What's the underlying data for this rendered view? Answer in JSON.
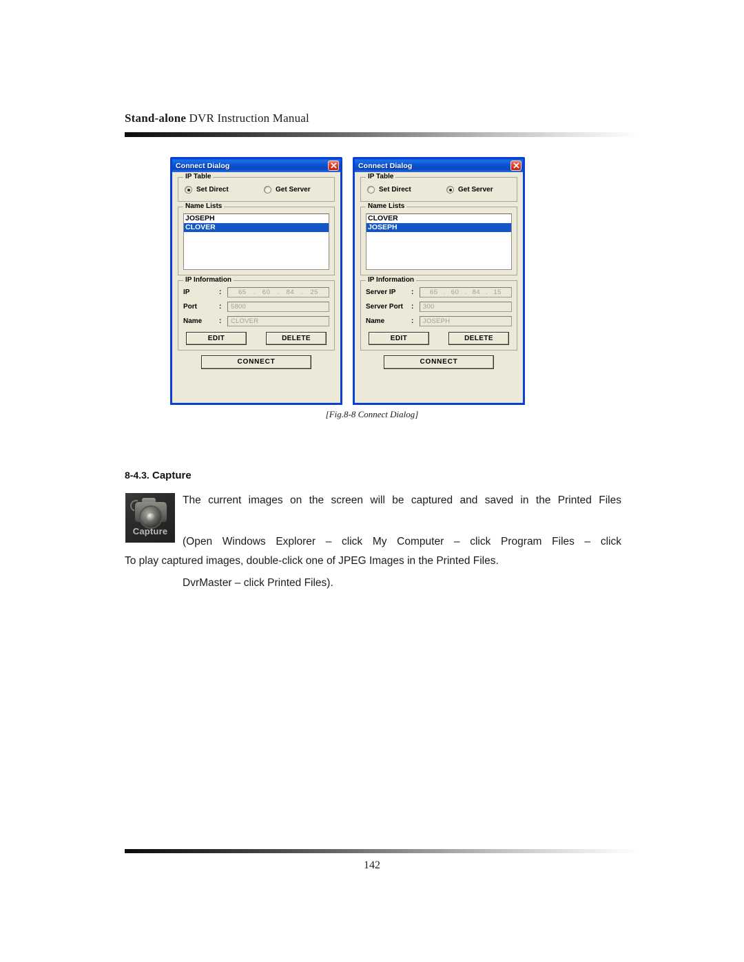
{
  "header": {
    "title_bold": "Stand-alone",
    "title_rest": " DVR Instruction Manual"
  },
  "figure": {
    "caption": "[Fig.8-8 Connect Dialog]",
    "dialogs": [
      {
        "title": "Connect Dialog",
        "close_icon": "close-icon",
        "ip_table": {
          "legend": "IP Table",
          "options": [
            {
              "label": "Set Direct",
              "selected": true
            },
            {
              "label": "Get Server",
              "selected": false
            }
          ]
        },
        "name_lists": {
          "legend": "Name Lists",
          "items": [
            {
              "label": "JOSEPH",
              "selected": false
            },
            {
              "label": "CLOVER",
              "selected": true
            }
          ]
        },
        "ip_information": {
          "legend": "IP Information",
          "fields": [
            {
              "label": "IP",
              "colon": ":",
              "type": "ip",
              "octets": [
                "65",
                "60",
                "84",
                "25"
              ],
              "dot": "."
            },
            {
              "label": "Port",
              "colon": ":",
              "type": "text",
              "value": "5800"
            },
            {
              "label": "Name",
              "colon": ":",
              "type": "text",
              "value": "CLOVER"
            }
          ],
          "edit_label": "EDIT",
          "delete_label": "DELETE"
        },
        "connect_label": "CONNECT"
      },
      {
        "title": "Connect Dialog",
        "close_icon": "close-icon",
        "ip_table": {
          "legend": "IP Table",
          "options": [
            {
              "label": "Set Direct",
              "selected": false
            },
            {
              "label": "Get Server",
              "selected": true
            }
          ]
        },
        "name_lists": {
          "legend": "Name Lists",
          "items": [
            {
              "label": "CLOVER",
              "selected": false
            },
            {
              "label": "JOSEPH",
              "selected": true
            }
          ]
        },
        "ip_information": {
          "legend": "IP Information",
          "fields": [
            {
              "label": "Server IP",
              "colon": ":",
              "type": "ip",
              "octets": [
                "65",
                "60",
                "84",
                "15"
              ],
              "dot": "."
            },
            {
              "label": "Server Port",
              "colon": ":",
              "type": "text",
              "value": "300"
            },
            {
              "label": "Name",
              "colon": ":",
              "type": "text",
              "value": "JOSEPH"
            }
          ],
          "edit_label": "EDIT",
          "delete_label": "DELETE"
        },
        "connect_label": "CONNECT"
      }
    ]
  },
  "section": {
    "heading_number": "8-4.3.",
    "heading_title": "Capture",
    "icon_label": "Capture",
    "paragraph_lines": [
      "The current images on the screen will be captured and saved in the Printed Files",
      "(Open Windows Explorer – click My Computer – click Program Files – click",
      "DvrMaster – click Printed Files)."
    ],
    "paragraph_2": "To play captured images, double-click one of JPEG Images in the Printed Files."
  },
  "footer": {
    "page_number": "142"
  },
  "colors": {
    "titlebar_blue": "#0a4fd0",
    "dialog_border_blue": "#0a3fd4",
    "dialog_face": "#ece9d8",
    "selection_blue": "#1456c8",
    "close_red": "#c21f10",
    "disabled_text": "#a5a198"
  }
}
